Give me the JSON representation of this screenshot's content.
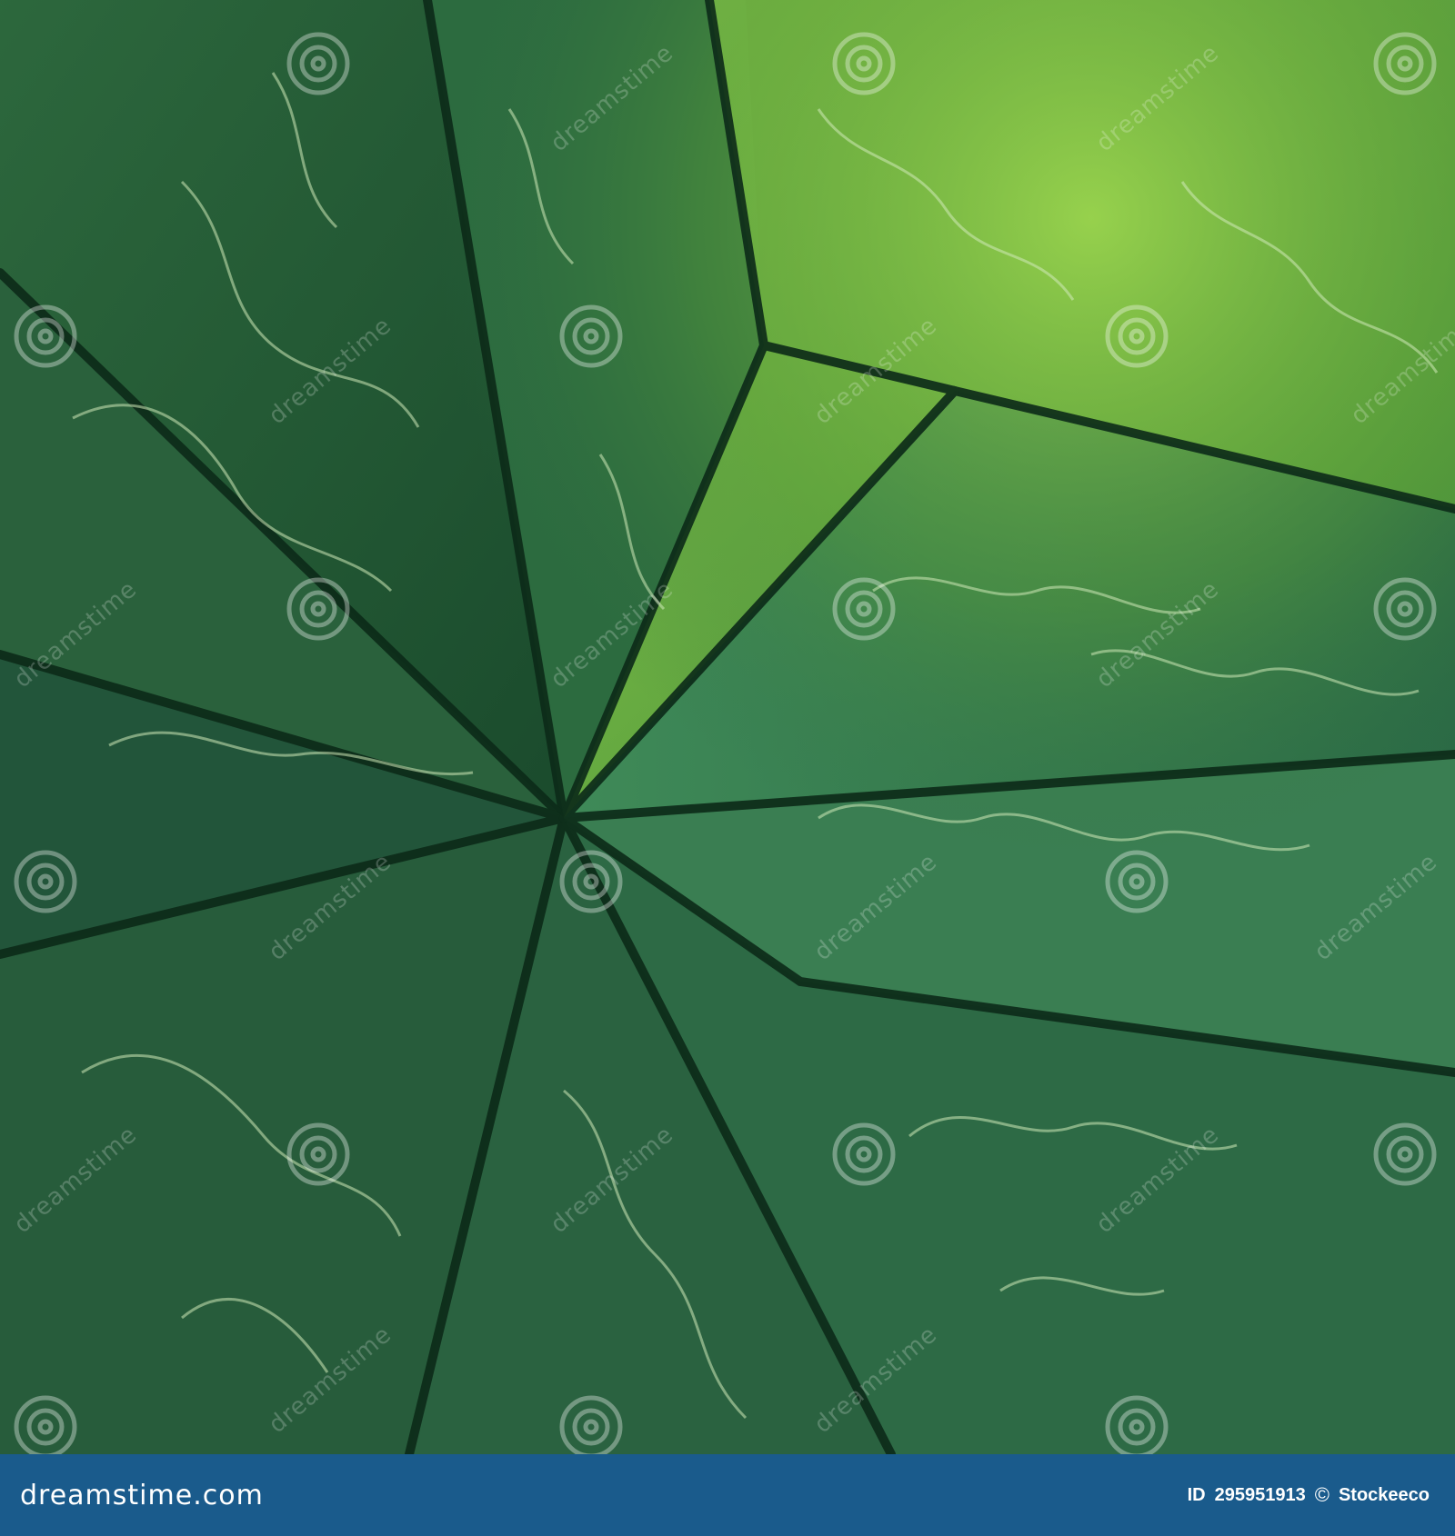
{
  "watermark": {
    "text": "dreamstime",
    "icon": "spiral-watermark-icon"
  },
  "footer": {
    "site": "dreamstime.com",
    "id_label": "ID",
    "id_value": "295951913",
    "copyright_symbol": "©",
    "author": "Stockeeco",
    "bar_color": "#1a5b8c"
  },
  "colors": {
    "leaf_dark": "#0f3a22",
    "leaf_mid": "#2f6e45",
    "leaf_light": "#7cc04a",
    "vein": "#cfe9b8"
  }
}
